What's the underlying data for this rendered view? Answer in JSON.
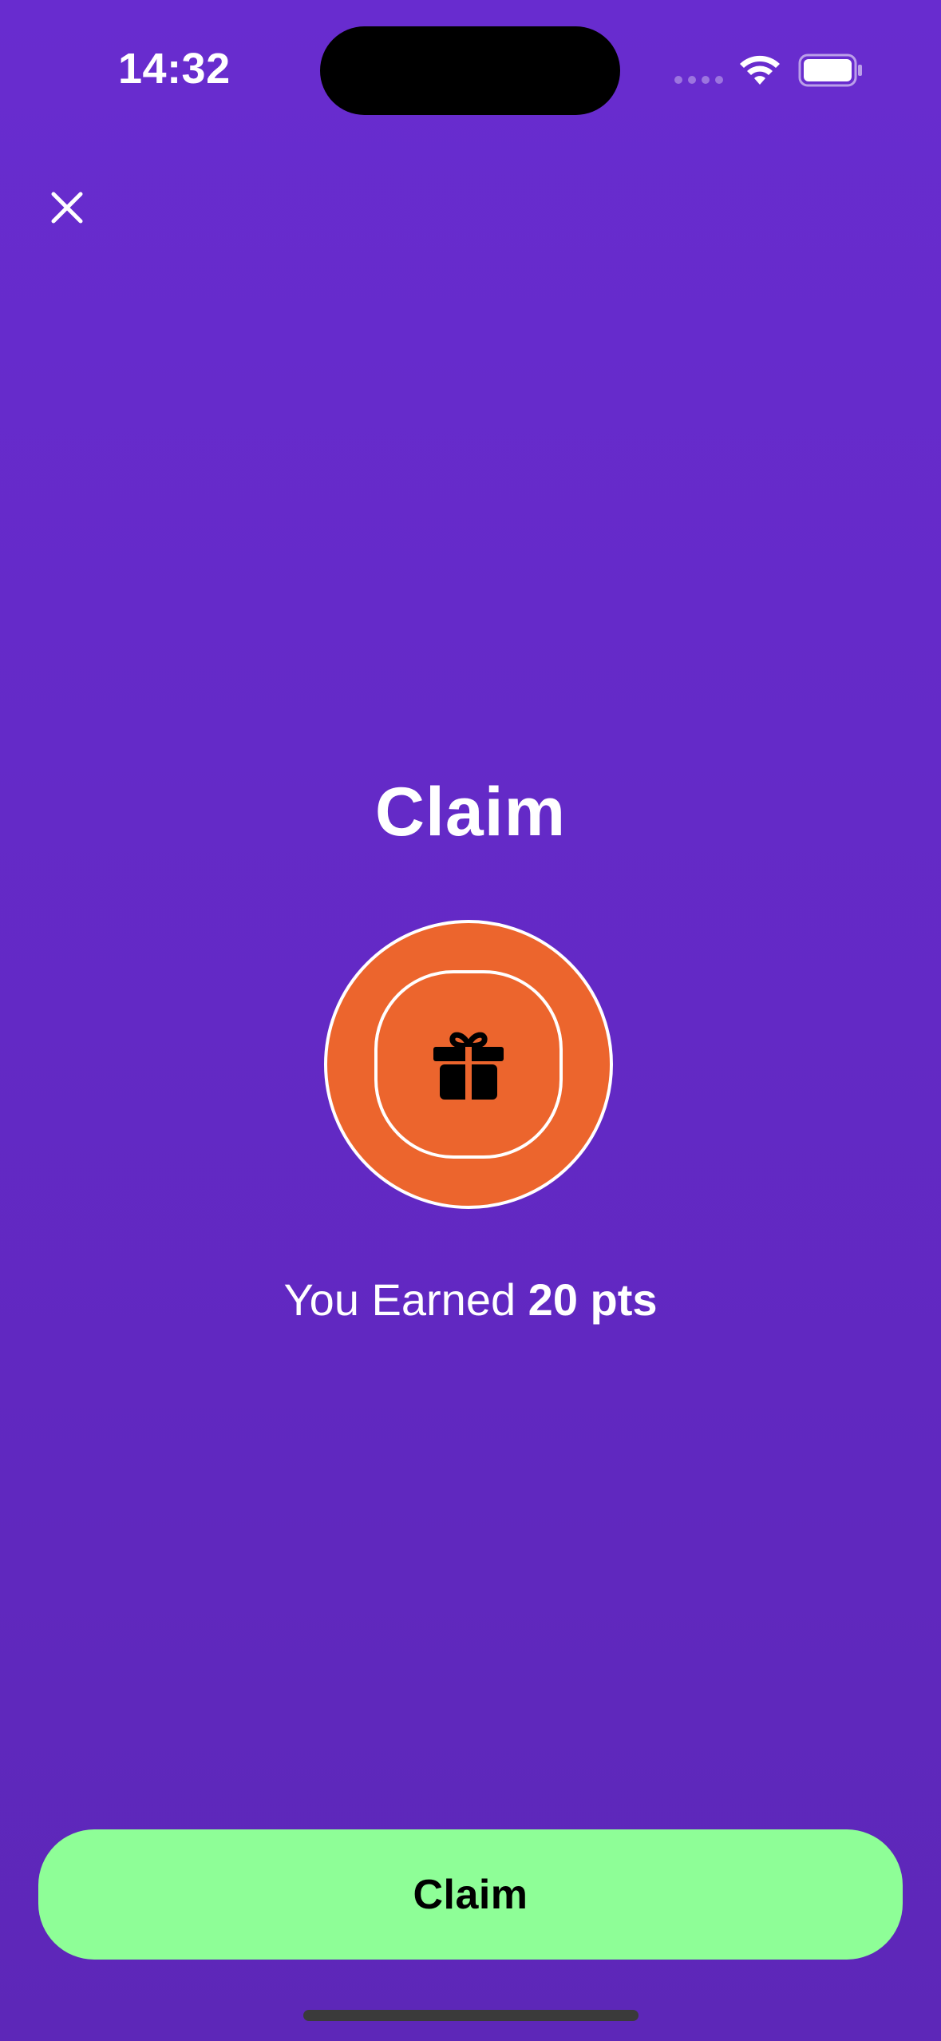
{
  "status_bar": {
    "time": "14:32",
    "icons": [
      "signal-dots-icon",
      "wifi-icon",
      "battery-icon"
    ]
  },
  "header": {
    "close_icon": "close-icon"
  },
  "main": {
    "title": "Claim",
    "badge_icon": "gift-icon",
    "earned_prefix": "You Earned",
    "earned_points": "20 pts"
  },
  "footer": {
    "claim_label": "Claim"
  },
  "colors": {
    "background": "#652ac9",
    "badge": "#ec652d",
    "claim_button": "#8efe97",
    "text": "#ffffff"
  }
}
